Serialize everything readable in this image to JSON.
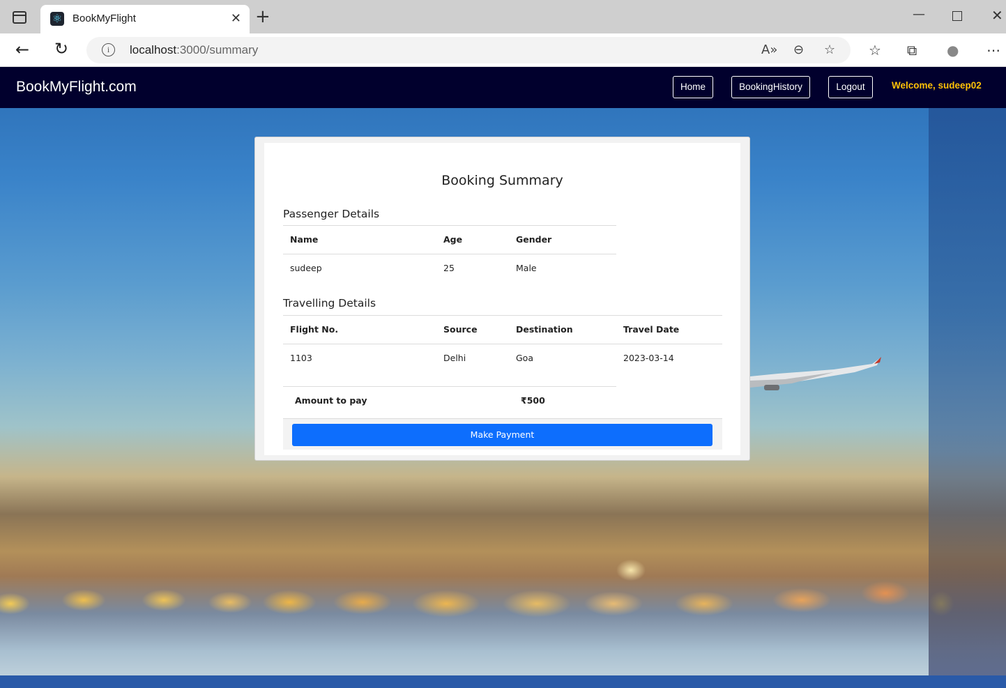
{
  "browser": {
    "tab_title": "BookMyFlight",
    "url_host": "localhost",
    "url_path": ":3000/summary",
    "new_tab_glyph": "+",
    "icons": [
      "tab-sidebar-icon",
      "react-favicon-icon",
      "close-tab-icon",
      "new-tab-icon",
      "minimize-icon",
      "maximize-icon",
      "close-window-icon",
      "back-icon",
      "reload-icon",
      "site-info-icon",
      "read-aloud-icon",
      "zoom-out-icon",
      "add-favorite-icon",
      "favorites-icon",
      "collections-icon",
      "profile-icon",
      "more-icon"
    ]
  },
  "navbar": {
    "brand": "BookMyFlight.com",
    "home": "Home",
    "history": "BookingHistory",
    "logout": "Logout",
    "welcome": "Welcome, sudeep02"
  },
  "summary": {
    "title": "Booking Summary",
    "passenger": {
      "heading": "Passenger Details",
      "columns": [
        "Name",
        "Age",
        "Gender"
      ],
      "rows": [
        [
          "sudeep",
          "25",
          "Male"
        ]
      ]
    },
    "travel": {
      "heading": "Travelling Details",
      "columns": [
        "Flight No.",
        "Source",
        "Destination",
        "Travel Date"
      ],
      "rows": [
        [
          "1103",
          "Delhi",
          "Goa",
          "2023-03-14"
        ]
      ]
    },
    "amount_label": "Amount to pay",
    "amount_value": "₹500",
    "pay_button": "Make Payment"
  },
  "colors": {
    "navbar_bg": "#01002d",
    "welcome": "#ffc107",
    "pay_button": "#0d6efd"
  }
}
